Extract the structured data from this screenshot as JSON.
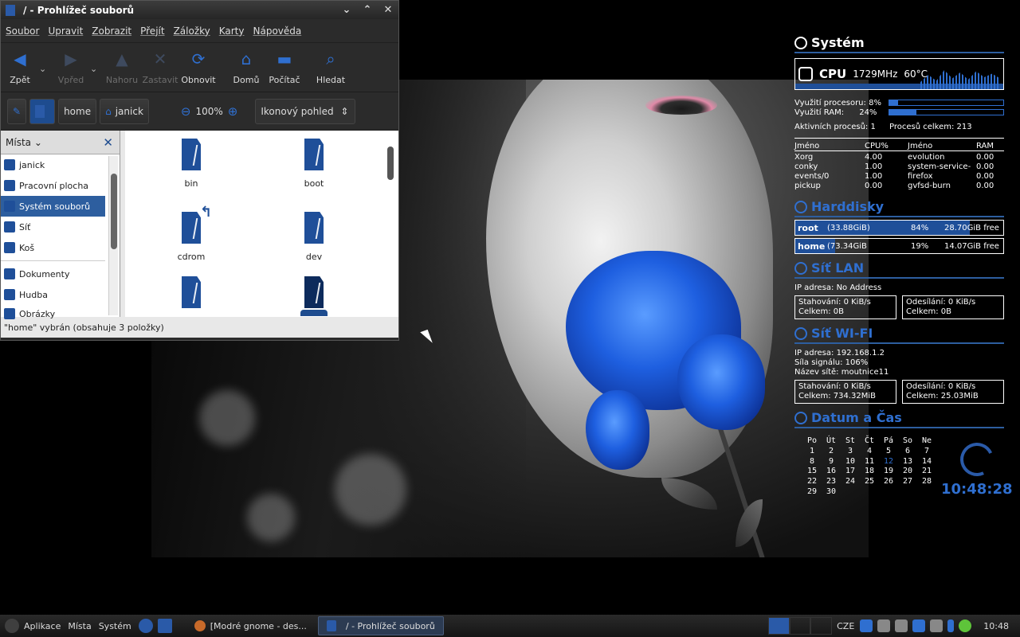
{
  "window": {
    "title": "/ - Prohlížeč souborů",
    "buttons": {
      "minimize": "⌄",
      "maximize": "⌃",
      "close": "✕"
    },
    "menu": [
      "Soubor",
      "Upravit",
      "Zobrazit",
      "Přejít",
      "Záložky",
      "Karty",
      "Nápověda"
    ],
    "toolbar": {
      "back": "Zpět",
      "forward": "Vpřed",
      "up": "Nahoru",
      "stop": "Zastavit",
      "reload": "Obnovit",
      "home": "Domů",
      "computer": "Počítač",
      "search": "Hledat"
    },
    "location": {
      "crumbs": [
        "home",
        "janick"
      ],
      "zoom": "100%",
      "view": "Ikonový pohled"
    },
    "sidebar": {
      "header": "Místa",
      "items": [
        {
          "label": "janick",
          "selected": false
        },
        {
          "label": "Pracovní plocha",
          "selected": false
        },
        {
          "label": "Systém souborů",
          "selected": true
        },
        {
          "label": "Síť",
          "selected": false
        },
        {
          "label": "Koš",
          "selected": false
        }
      ],
      "bookmarks": [
        "Dokumenty",
        "Hudba",
        "Obrázky"
      ]
    },
    "files": [
      "bin",
      "boot",
      "cdrom",
      "dev",
      "",
      ""
    ],
    "status": "\"home\" vybrán (obsahuje 3 položky)"
  },
  "conky": {
    "system": {
      "header": "Systém",
      "cpu_label": "CPU",
      "cpu_freq": "1729MHz",
      "cpu_temp": "60°C",
      "cpu_usage_label": "Využití procesoru:",
      "cpu_usage": "8%",
      "cpu_usage_pct": 8,
      "ram_label": "Využití RAM:",
      "ram_usage": "24%",
      "ram_usage_pct": 24,
      "active_label": "Aktivních procesů: 1",
      "total_label": "Procesů celkem: 213",
      "proc_headers": [
        "Jméno",
        "CPU%",
        "Jméno",
        "RAM"
      ],
      "procs": [
        [
          "Xorg",
          "4.00",
          "evolution",
          "0.00"
        ],
        [
          "conky",
          "1.00",
          "system-service-",
          "0.00"
        ],
        [
          "events/0",
          "1.00",
          "firefox",
          "0.00"
        ],
        [
          "pickup",
          "0.00",
          "gvfsd-burn",
          "0.00"
        ]
      ]
    },
    "disks": {
      "header": "Harddisky",
      "items": [
        {
          "name": "root",
          "size": "(33.88GiB)",
          "pct": "84%",
          "pct_value": 84,
          "free": "28.70GiB free"
        },
        {
          "name": "home",
          "size": "(73.34GiB",
          "pct": "19%",
          "pct_value": 19,
          "free": "14.07GiB free"
        }
      ]
    },
    "lan": {
      "header": "Síť LAN",
      "ip": "IP adresa: No Address",
      "down": "Stahování:  0  KiB/s",
      "down_total": "Celkem: 0B",
      "up": "Odesílání: 0 KiB/s",
      "up_total": "Celkem:   0B"
    },
    "wifi": {
      "header": "Síť WI-FI",
      "ip": "IP adresa: 192.168.1.2",
      "signal": "Síla signálu: 106%",
      "ssid": "Název sítě: moutnice11",
      "down": "Stahování:  0  KiB/s",
      "down_total": "Celkem: 734.32MiB",
      "up": "Odesílání: 0 KiB/s",
      "up_total": "Celkem:  25.03MiB"
    },
    "datetime": {
      "header": "Datum a Čas",
      "days": [
        "Po",
        "Út",
        "St",
        "Čt",
        "Pá",
        "So",
        "Ne"
      ],
      "dates": [
        "1",
        "2",
        "3",
        "4",
        "5",
        "6",
        "7",
        "8",
        "9",
        "10",
        "11",
        "12",
        "13",
        "14",
        "15",
        "16",
        "17",
        "18",
        "19",
        "20",
        "21",
        "22",
        "23",
        "24",
        "25",
        "26",
        "27",
        "28",
        "29",
        "30"
      ],
      "today": "12",
      "time": "10:48:28"
    }
  },
  "taskbar": {
    "apps": "Aplikace",
    "places": "Místa",
    "system": "Systém",
    "task1": "[Modré gnome - des...",
    "task2": "/ - Prohlížeč souborů",
    "keyboard": "CZE",
    "clock": "10:48"
  },
  "colors": {
    "accent": "#2f6fd0",
    "dark_blue": "#1f4f99",
    "selection": "#2d5e9f"
  }
}
